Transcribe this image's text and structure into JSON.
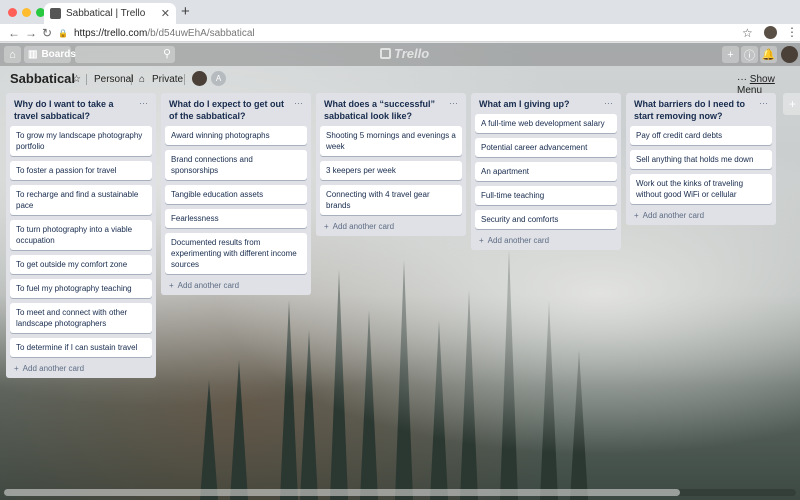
{
  "browser": {
    "tab_title": "Sabbatical | Trello",
    "tab_close": "✕",
    "new_tab": "+",
    "url_host": "https://trello.com",
    "url_path": "/b/d54uwEhA/sabbatical",
    "traffic_lights": [
      "#ff5f57",
      "#febc2e",
      "#28c840"
    ]
  },
  "nav": {
    "boards_label": "Boards",
    "logo_text": "Trello",
    "add_icon": "+",
    "info_icon": "ⓘ",
    "bell_icon": "🔔",
    "home_icon": "⌂",
    "search_icon": "⚲"
  },
  "board": {
    "title": "Sabbatical",
    "visibility_team": "Personal",
    "visibility_privacy": "Private",
    "show_menu_icon": "···",
    "show_menu_label": "Show Menu",
    "member_initial": "A"
  },
  "lists": [
    {
      "title": "Why do I want to take a travel sabbatical?",
      "cards": [
        "To grow my landscape photography portfolio",
        "To foster a passion for travel",
        "To recharge and find a sustainable pace",
        "To turn photography into a viable occupation",
        "To get outside my comfort zone",
        "To fuel my photography teaching",
        "To meet and connect with other landscape photographers",
        "To determine if I can sustain travel"
      ],
      "add_label": "Add another card"
    },
    {
      "title": "What do I expect to get out of the sabbatical?",
      "cards": [
        "Award winning photographs",
        "Brand connections and sponsorships",
        "Tangible education assets",
        "Fearlessness",
        "Documented results from experimenting with different income sources"
      ],
      "add_label": "Add another card"
    },
    {
      "title": "What does a “successful” sabbatical look like?",
      "cards": [
        "Shooting 5 mornings and evenings a week",
        "3 keepers per week",
        "Connecting with 4 travel gear brands"
      ],
      "add_label": "Add another card"
    },
    {
      "title": "What am I giving up?",
      "cards": [
        "A full-time web development salary",
        "Potential career advancement",
        "An apartment",
        "Full-time teaching",
        "Security and comforts"
      ],
      "add_label": "Add another card"
    },
    {
      "title": "What barriers do I need to start removing now?",
      "cards": [
        "Pay off credit card debts",
        "Sell anything that holds me down",
        "Work out the kinks of traveling without good WiFi or cellular"
      ],
      "add_label": "Add another card"
    }
  ]
}
